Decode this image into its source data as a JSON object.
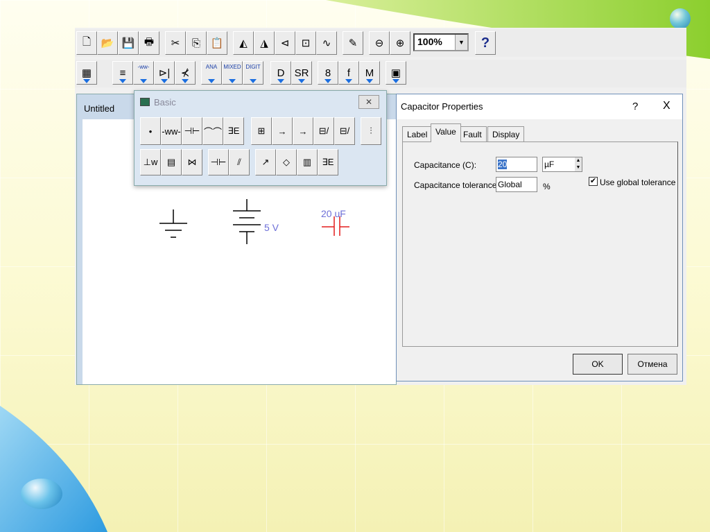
{
  "toolbar1": {
    "buttons": [
      {
        "n": "new-icon",
        "g": "🗋"
      },
      {
        "n": "open-icon",
        "g": "📂"
      },
      {
        "n": "save-icon",
        "g": "💾"
      },
      {
        "n": "print-icon",
        "g": "🖶"
      },
      {
        "n": "cut-icon",
        "g": "✂"
      },
      {
        "n": "copy-icon",
        "g": "⎘"
      },
      {
        "n": "paste-icon",
        "g": "📋"
      },
      {
        "n": "rotate-icon",
        "g": "◭"
      },
      {
        "n": "flip-horizontal-icon",
        "g": "◮"
      },
      {
        "n": "flip-vertical-icon",
        "g": "⊲"
      },
      {
        "n": "component-properties-icon",
        "g": "⊡"
      },
      {
        "n": "analysis-graph-icon",
        "g": "∿"
      },
      {
        "n": "edit-check-icon",
        "g": "✎"
      },
      {
        "n": "zoom-out-icon",
        "g": "⊖"
      },
      {
        "n": "zoom-in-icon",
        "g": "⊕"
      }
    ],
    "zoom": "100%",
    "help": "?"
  },
  "toolbar2": {
    "buttons": [
      {
        "n": "parts-bin-icon",
        "g": "▦"
      },
      {
        "n": "sources-icon",
        "g": "≡"
      },
      {
        "n": "basic-icon",
        "g": "-ww-"
      },
      {
        "n": "diodes-icon",
        "g": "⊳|"
      },
      {
        "n": "transistors-icon",
        "g": "⊀"
      },
      {
        "n": "analog-ic-icon",
        "g": "ANA"
      },
      {
        "n": "mixed-ic-icon",
        "g": "MIXED"
      },
      {
        "n": "digital-ic-icon",
        "g": "DIGIT"
      },
      {
        "n": "logic-gates-icon",
        "g": "D"
      },
      {
        "n": "digital-icon",
        "g": "SR"
      },
      {
        "n": "indicators-icon",
        "g": "8"
      },
      {
        "n": "controls-icon",
        "g": "f"
      },
      {
        "n": "misc-icon",
        "g": "M"
      },
      {
        "n": "instruments-icon",
        "g": "▣"
      }
    ]
  },
  "circuit": {
    "title": "Untitled",
    "battery_label": "5 V",
    "capacitor_label": "20 uF"
  },
  "palette": {
    "title": "Basic",
    "row1": [
      "•",
      "-ww-",
      "⊣⊢",
      "⌒⌒",
      "∃E",
      "⊞",
      "→",
      "→",
      "⊟/",
      "⊟/",
      "⫶"
    ],
    "row2": [
      "⊥w",
      "▤",
      "⋈",
      "⊣⊢",
      "⫽",
      "↗",
      "◇",
      "▥",
      "∃E"
    ]
  },
  "dialog": {
    "title": "Capacitor Properties",
    "help": "?",
    "close": "X",
    "tabs": [
      "Label",
      "Value",
      "Fault",
      "Display"
    ],
    "active_tab": "Value",
    "capacitance_label": "Capacitance (C):",
    "capacitance_value": "20",
    "capacitance_unit": "µF",
    "tolerance_label": "Capacitance tolerance:",
    "tolerance_value": "Global",
    "tolerance_unit": "%",
    "global_tolerance_label": "Use global tolerance",
    "global_tolerance_checked": true,
    "ok": "OK",
    "cancel": "Отмена"
  }
}
